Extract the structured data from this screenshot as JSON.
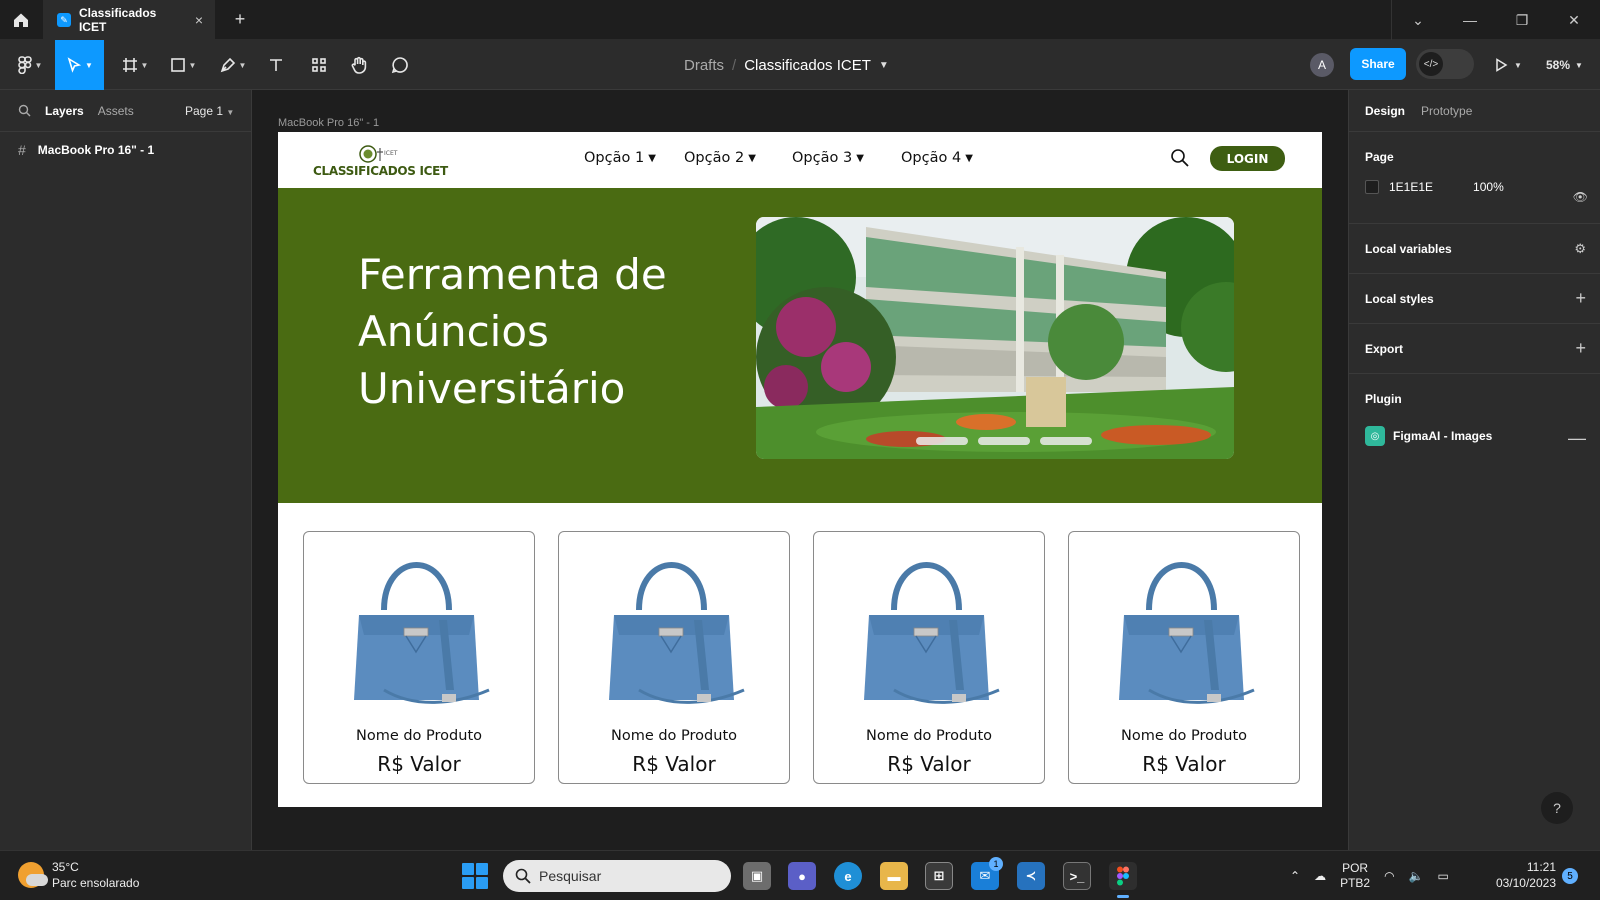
{
  "titlebar": {
    "tab_title": "Classificados ICET",
    "tab_close": "×",
    "new_tab": "+"
  },
  "toolbar": {
    "breadcrumb_parent": "Drafts",
    "breadcrumb_separator": "/",
    "file_name": "Classificados ICET",
    "avatar_initial": "A",
    "share_label": "Share",
    "zoom": "58%",
    "accent": "#0d99ff"
  },
  "left_panel": {
    "tab_layers": "Layers",
    "tab_assets": "Assets",
    "page_selector": "Page 1",
    "layer_name": "MacBook Pro 16\" - 1"
  },
  "right_panel": {
    "tab_design": "Design",
    "tab_prototype": "Prototype",
    "page_heading": "Page",
    "page_color": "1E1E1E",
    "page_opacity": "100%",
    "local_variables": "Local variables",
    "local_styles": "Local styles",
    "export": "Export",
    "plugin_heading": "Plugin",
    "plugin_name": "FigmaAI - Images"
  },
  "canvas": {
    "frame_label": "MacBook Pro 16\" - 1"
  },
  "site": {
    "logo_text": "CLASSIFICADOS ICET",
    "logo_small": "ICET",
    "menu": [
      "Opção 1",
      "Opção 2",
      "Opção 3",
      "Opção 4"
    ],
    "login_label": "LOGIN",
    "hero_title_lines": [
      "Ferramenta de",
      "Anúncios",
      "Universitário"
    ],
    "brand_green": "#4a6b12",
    "products": [
      {
        "name": "Nome do Produto",
        "price": "R$ Valor"
      },
      {
        "name": "Nome do Produto",
        "price": "R$ Valor"
      },
      {
        "name": "Nome do Produto",
        "price": "R$ Valor"
      },
      {
        "name": "Nome do Produto",
        "price": "R$ Valor"
      }
    ]
  },
  "taskbar": {
    "temperature": "35°C",
    "weather_desc": "Parc ensolarado",
    "search_placeholder": "Pesquisar",
    "lang_line1": "POR",
    "lang_line2": "PTB2",
    "time": "11:21",
    "date": "03/10/2023",
    "notification_count": "5",
    "mail_badge": "1"
  }
}
